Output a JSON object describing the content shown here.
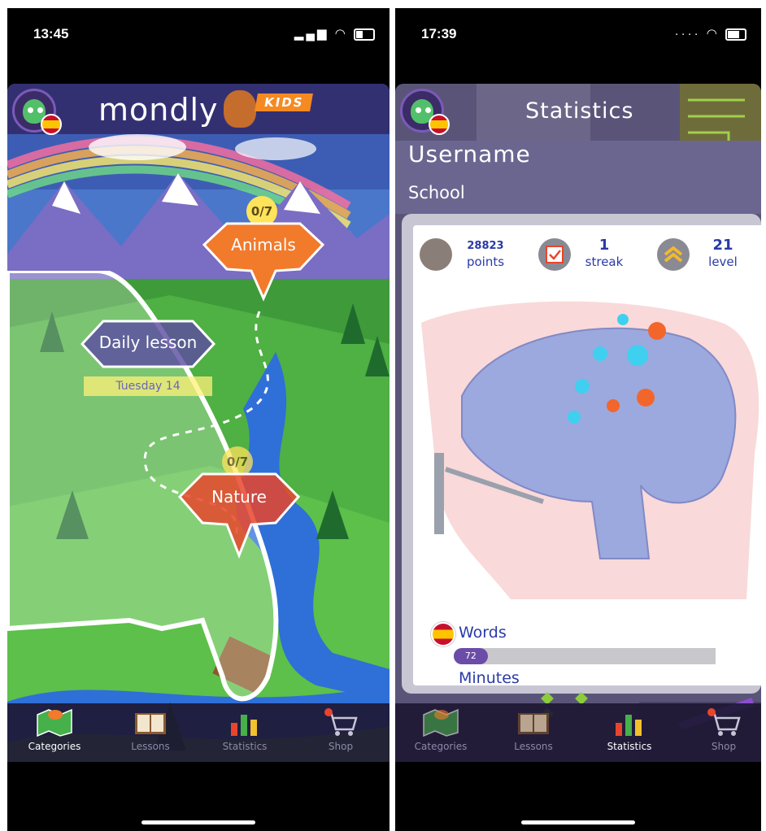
{
  "left_phone": {
    "status": {
      "time": "13:45"
    },
    "header": {
      "logo_text": "mondly",
      "kids_label": "KIDS"
    },
    "map": {
      "animals": {
        "label": "Animals",
        "progress": "0/7"
      },
      "daily_lesson": {
        "label": "Daily lesson",
        "date": "Tuesday 14"
      },
      "nature": {
        "label": "Nature",
        "progress": "0/7"
      }
    },
    "tabs": [
      {
        "label": "Categories",
        "active": true
      },
      {
        "label": "Lessons",
        "active": false
      },
      {
        "label": "Statistics",
        "active": false
      },
      {
        "label": "Shop",
        "active": false
      }
    ]
  },
  "right_phone": {
    "status": {
      "time": "17:39"
    },
    "header": {
      "title": "Statistics"
    },
    "profile": {
      "username": "Username",
      "school": "School"
    },
    "stats": {
      "points": {
        "value": "28823",
        "label": "points"
      },
      "streak": {
        "value": "1",
        "label": "streak"
      },
      "level": {
        "value": "21",
        "label": "level"
      }
    },
    "words": {
      "label": "Words",
      "count": "72",
      "fill_fraction": 0.13
    },
    "minutes": {
      "label": "Minutes"
    },
    "pager_dots": 3,
    "tabs": [
      {
        "label": "Categories",
        "active": false
      },
      {
        "label": "Lessons",
        "active": false
      },
      {
        "label": "Statistics",
        "active": true
      },
      {
        "label": "Shop",
        "active": false
      }
    ]
  },
  "colors": {
    "accent_orange": "#f58a23",
    "nature_red": "#e8452c",
    "daily_purple": "#5b4aa3",
    "stats_blue": "#2a3aa8",
    "progress_purple": "#6b4ca8"
  }
}
